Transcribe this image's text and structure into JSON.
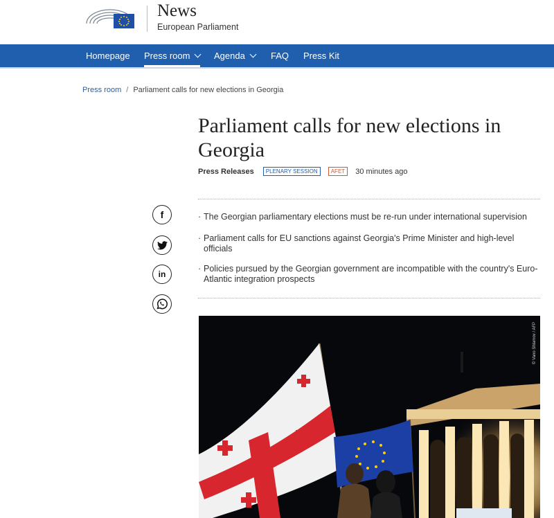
{
  "header": {
    "logo_alt": "European Parliament logo",
    "title": "News",
    "subtitle": "European Parliament"
  },
  "nav": {
    "items": [
      {
        "label": "Homepage",
        "active": false,
        "has_dropdown": false
      },
      {
        "label": "Press room",
        "active": true,
        "has_dropdown": true
      },
      {
        "label": "Agenda",
        "active": false,
        "has_dropdown": true
      },
      {
        "label": "FAQ",
        "active": false,
        "has_dropdown": false
      },
      {
        "label": "Press Kit",
        "active": false,
        "has_dropdown": false
      }
    ]
  },
  "breadcrumb": {
    "root": "Press room",
    "separator": "/",
    "current": "Parliament calls for new elections in Georgia"
  },
  "article": {
    "title": "Parliament calls for new elections in Georgia",
    "type": "Press Releases",
    "tags": [
      "PLENARY SESSION",
      "AFET"
    ],
    "time": "30 minutes ago",
    "highlights": [
      "The Georgian parliamentary elections must be re-run under international supervision",
      "Parliament calls for EU sanctions against Georgia's Prime Minister and high-level officials",
      "Policies pursued by the Georgian government are incompatible with the country's Euro-Atlantic integration prospects"
    ]
  },
  "share": {
    "icons": [
      "facebook-icon",
      "twitter-icon",
      "linkedin-icon",
      "whatsapp-icon"
    ],
    "facebook_glyph": "f",
    "linkedin_glyph": "in"
  },
  "photo": {
    "credit": "© Vano Shlamov / AFP"
  },
  "colors": {
    "nav_bg": "#1f5fad",
    "tag_blue": "#1f5fad",
    "tag_orange": "#d5562b",
    "flag_red": "#d8262e",
    "eu_blue": "#1c3fa6",
    "eu_gold": "#ffcc00"
  }
}
